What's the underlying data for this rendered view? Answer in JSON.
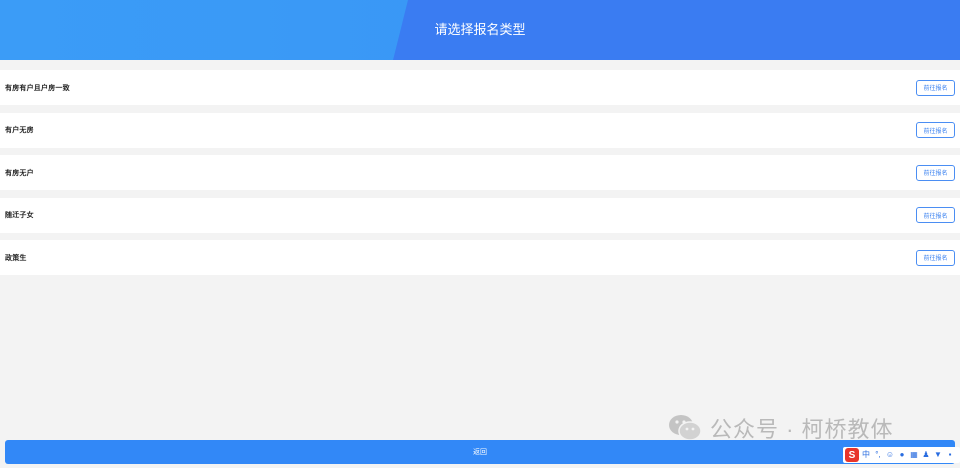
{
  "header": {
    "title": "请选择报名类型"
  },
  "options": [
    {
      "label": "有房有户且户房一致",
      "button": "前往报名"
    },
    {
      "label": "有户无房",
      "button": "前往报名"
    },
    {
      "label": "有房无户",
      "button": "前往报名"
    },
    {
      "label": "随迁子女",
      "button": "前往报名"
    },
    {
      "label": "政策生",
      "button": "前往报名"
    }
  ],
  "watermark": {
    "text": "公众号 · 柯桥教体",
    "icon": "wechat-icon"
  },
  "footer": {
    "back_label": "返回"
  },
  "ime_toolbar": {
    "logo": "S",
    "mode": "中",
    "icons": [
      "punctuation-icon",
      "emoji-icon",
      "mic-icon",
      "keyboard-icon",
      "user-icon",
      "skin-icon",
      "grid-icon"
    ]
  },
  "colors": {
    "header_left": "#3b9cf7",
    "header_right": "#3a7cf2",
    "accent": "#3288f7",
    "background": "#f3f3f3"
  }
}
